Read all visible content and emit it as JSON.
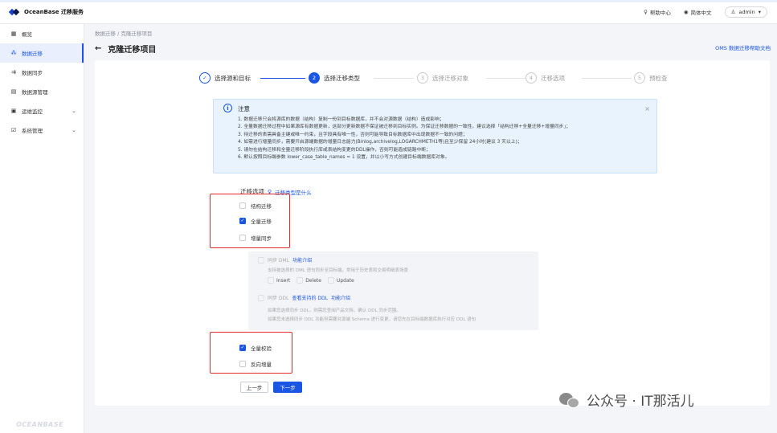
{
  "app": {
    "logo_text": "OceanBase 迁移服务",
    "footer_brand": "OCEANBASE"
  },
  "topbar": {
    "help": "帮助中心",
    "language": "简体中文",
    "user": "admin"
  },
  "sidebar": {
    "items": [
      {
        "label": "概览",
        "icon": "grid-icon"
      },
      {
        "label": "数据迁移",
        "icon": "migrate-icon"
      },
      {
        "label": "数据同步",
        "icon": "sync-icon"
      },
      {
        "label": "数据源管理",
        "icon": "datasource-icon"
      },
      {
        "label": "运维监控",
        "icon": "monitor-icon"
      },
      {
        "label": "系统管理",
        "icon": "system-icon"
      }
    ]
  },
  "breadcrumb": "数据迁移 / 克隆迁移项目",
  "page": {
    "title": "克隆迁移项目",
    "help_link": "OMS 数据迁移帮助文档"
  },
  "steps": [
    {
      "num": "✓",
      "label": "选择源和目标"
    },
    {
      "num": "2",
      "label": "选择迁移类型"
    },
    {
      "num": "3",
      "label": "选择迁移对象"
    },
    {
      "num": "4",
      "label": "迁移选项"
    },
    {
      "num": "5",
      "label": "预检查"
    }
  ],
  "notice": {
    "title": "注意",
    "lines": [
      "1. 数据迁移只会将源库的数据（结构）复制一份到目标数据库，并不会对源数据（结构）造成影响；",
      "2. 全量数据迁移过程中如果源库有数据更新，这部分更新数据不保证被迁移到目标实例。为保证迁移数据的一致性，建议选择「结构迁移+全量迁移+增量同步」；",
      "3. 待迁移的表需具备主键或唯一约束，且字段具有唯一性，否则可能导致目标数据库中出现数据不一致的问题；",
      "4. 如需进行增量同步，需要开启源端数据的增量日志能力(Binlog,archivelog,LOGARCHMETH1等)且至少保留 24小时(建议 3 天以上)；",
      "5. 请勿在结构迁移和全量迁移阶段执行库或表结构变更的DDL操作，否则可能造成链路中断；",
      "6. 默认按照目标端参数 lower_case_table_names = 1 设置，并以小写方式创建目标端数据库对象。"
    ]
  },
  "options": {
    "label": "迁移选项",
    "hint_link": "迁移类型是什么",
    "schema_migration": "结构迁移",
    "full_migration": "全量迁移",
    "incremental_sync": "增量同步",
    "sub": {
      "sync_dml": "同步 DML",
      "dml_intro": "功能介绍",
      "dml_desc": "支持被选择的 DML 语句同步至目标端，常用于历史表和交易明细表场景",
      "dml_insert": "Insert",
      "dml_delete": "Delete",
      "dml_update": "Update",
      "sync_ddl": "同步 DDL",
      "ddl_supported": "查看支持的 DDL",
      "ddl_intro": "功能介绍",
      "ddl_desc1": "如果您选择同步 DDL，则需您查阅产品文档，确认 DDL 同步范围。",
      "ddl_desc2": "如果您未选择同步 DDL 功能但需要对源端 Schema 进行变更，请您先在目标端数据库执行对应 DDL 语句"
    },
    "full_verification": "全量校验",
    "reverse_increment": "反向增量"
  },
  "buttons": {
    "prev": "上一步",
    "next": "下一步"
  },
  "watermark": "公众号 · IT那活儿"
}
